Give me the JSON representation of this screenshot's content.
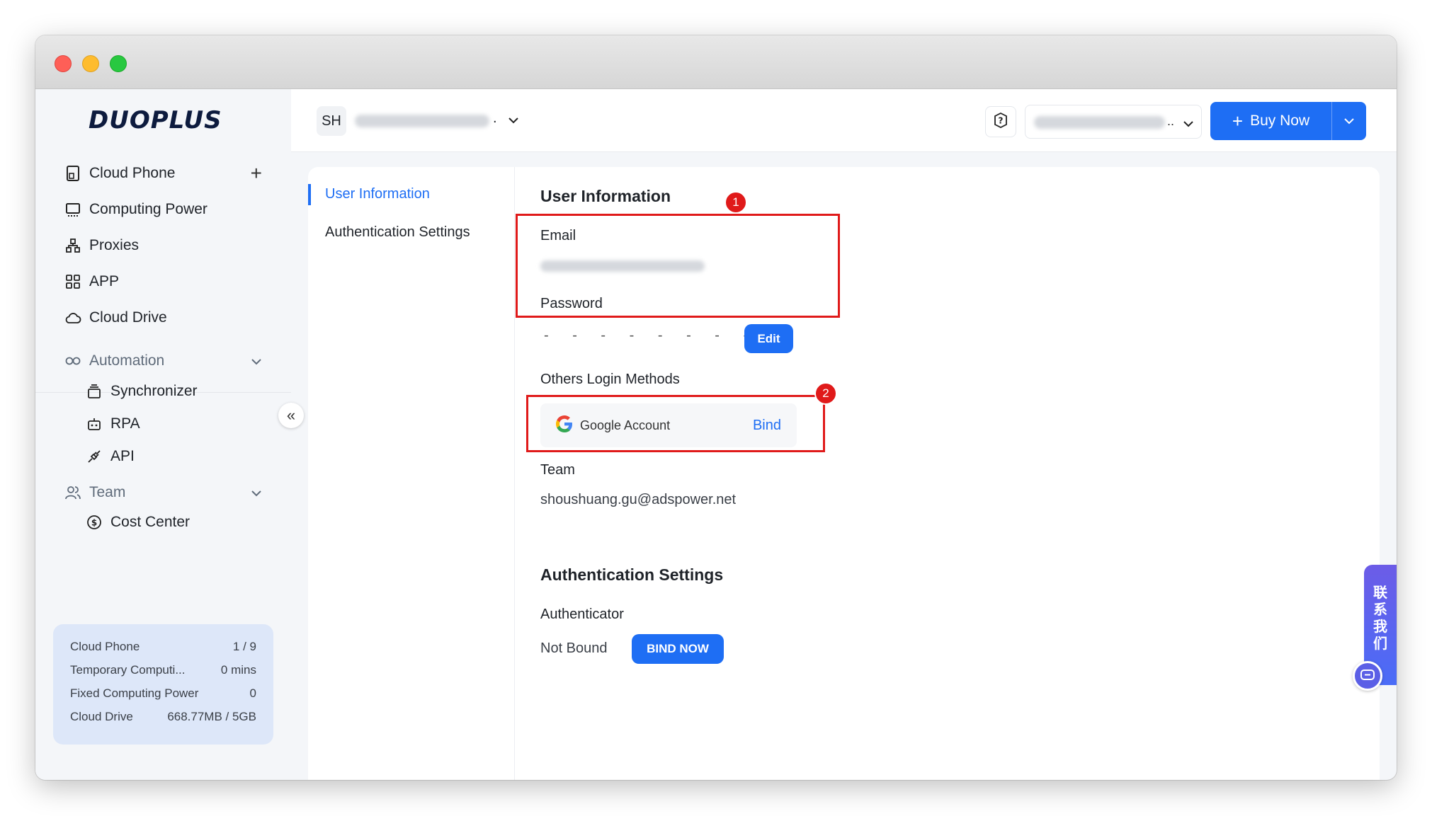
{
  "sidebar": {
    "logo_main": "DUOPLUS",
    "items": [
      {
        "label": "Cloud Phone"
      },
      {
        "label": "Computing Power"
      },
      {
        "label": "Proxies"
      },
      {
        "label": "APP"
      },
      {
        "label": "Cloud Drive"
      }
    ],
    "automation": {
      "label": "Automation",
      "children": [
        {
          "label": "Synchronizer"
        },
        {
          "label": "RPA"
        },
        {
          "label": "API"
        }
      ]
    },
    "team": {
      "label": "Team",
      "children": [
        {
          "label": "Cost Center"
        }
      ]
    },
    "usage": [
      {
        "label": "Cloud Phone",
        "value": "1 / 9"
      },
      {
        "label": "Temporary Computi...",
        "value": "0 mins"
      },
      {
        "label": "Fixed Computing Power",
        "value": "0"
      },
      {
        "label": "Cloud Drive",
        "value": "668.77MB / 5GB"
      }
    ]
  },
  "topbar": {
    "avatar_initials": "SH",
    "account_suffix": ".",
    "account_select_suffix": "..",
    "buy_label": "Buy Now"
  },
  "subnav": {
    "items": [
      {
        "label": "User Information"
      },
      {
        "label": "Authentication Settings"
      }
    ]
  },
  "user_info": {
    "title": "User Information",
    "email_label": "Email",
    "password_label": "Password",
    "password_mask": "- - - - - - - -",
    "edit_label": "Edit",
    "others_label": "Others Login Methods",
    "google_label": "Google Account",
    "bind_label": "Bind",
    "team_label": "Team",
    "team_value": "shoushuang.gu@adspower.net"
  },
  "auth_settings": {
    "title": "Authentication Settings",
    "authenticator_label": "Authenticator",
    "status": "Not Bound",
    "bind_now_label": "BIND NOW"
  },
  "annotations": [
    "1",
    "2"
  ],
  "contact": {
    "chars": [
      "联",
      "系",
      "我",
      "们"
    ]
  },
  "colors": {
    "primary": "#1e6ef4",
    "annotation": "#e01a1a",
    "sidebar_bg": "#f4f6f9",
    "usage_bg": "#dde7f9"
  }
}
